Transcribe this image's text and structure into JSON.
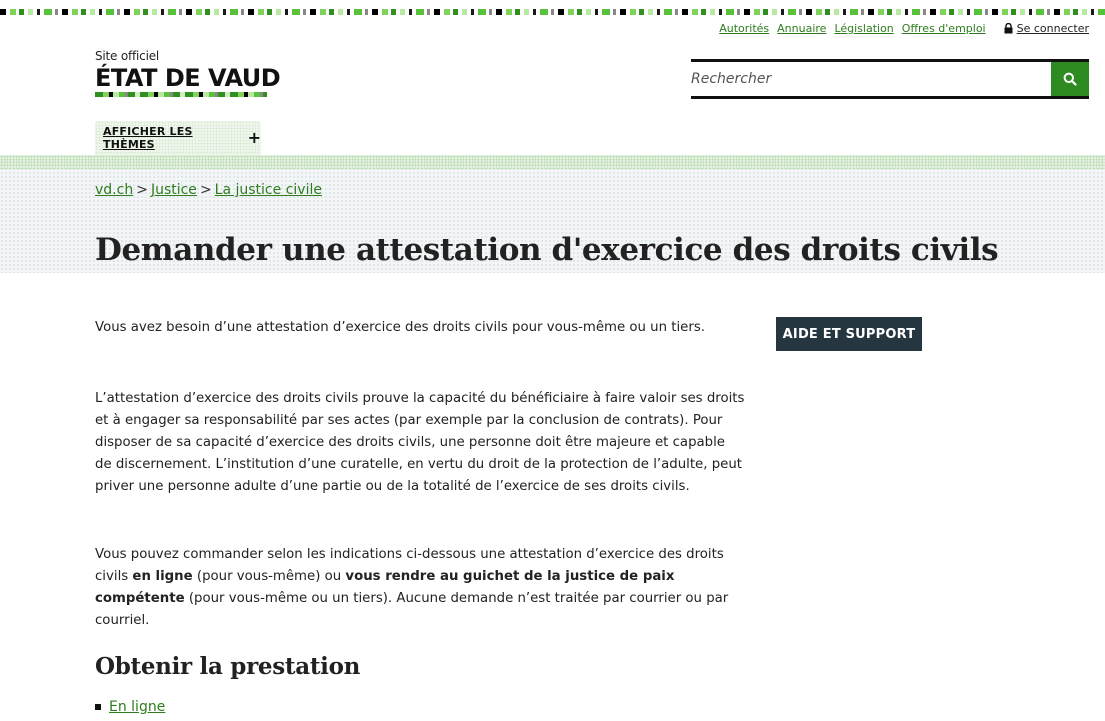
{
  "utility_links": [
    "Autorités",
    "Annuaire",
    "Législation",
    "Offres d'emploi"
  ],
  "login_label": "Se connecter",
  "logo": {
    "subtitle": "Site officiel",
    "title": "ÉTAT DE VAUD"
  },
  "search": {
    "placeholder": "Rechercher"
  },
  "themes_label": "AFFICHER LES THÈMES",
  "breadcrumb": [
    "vd.ch",
    "Justice",
    "La justice civile"
  ],
  "page_title": "Demander une attestation d'exercice des droits civils",
  "help_button": "AIDE ET SUPPORT",
  "paragraphs": {
    "p1": "Vous avez besoin d’une attestation d’exercice des droits civils pour vous-même ou un tiers.",
    "p2": "L’attestation d’exercice des droits civils prouve la capacité du bénéficiaire à faire valoir ses droits et à engager sa responsabilité par ses actes (par exemple par la conclusion de contrats). Pour disposer de sa capacité d’exercice des droits civils, une personne doit être majeure et capable de discernement. L’institution d’une curatelle, en vertu du droit de la protection de l’adulte, peut priver une personne adulte d’une partie ou de la totalité de l’exercice de ses droits civils.",
    "p3_part1": "Vous pouvez commander selon les indications ci-dessous une attestation d’exercice des droits civils ",
    "p3_bold1": "en ligne",
    "p3_part2": " (pour vous-même) ou ",
    "p3_bold2": "vous rendre au guichet de la justice de paix compétente",
    "p3_part3": " (pour vous-même ou un tiers). Aucune demande n’est traitée par courrier ou par courriel."
  },
  "section_title": "Obtenir la prestation",
  "service_links": [
    "En ligne"
  ],
  "colors": {
    "accent_green": "#2e8b22",
    "link_green": "#2e7d1f",
    "dark_button": "#253641"
  }
}
